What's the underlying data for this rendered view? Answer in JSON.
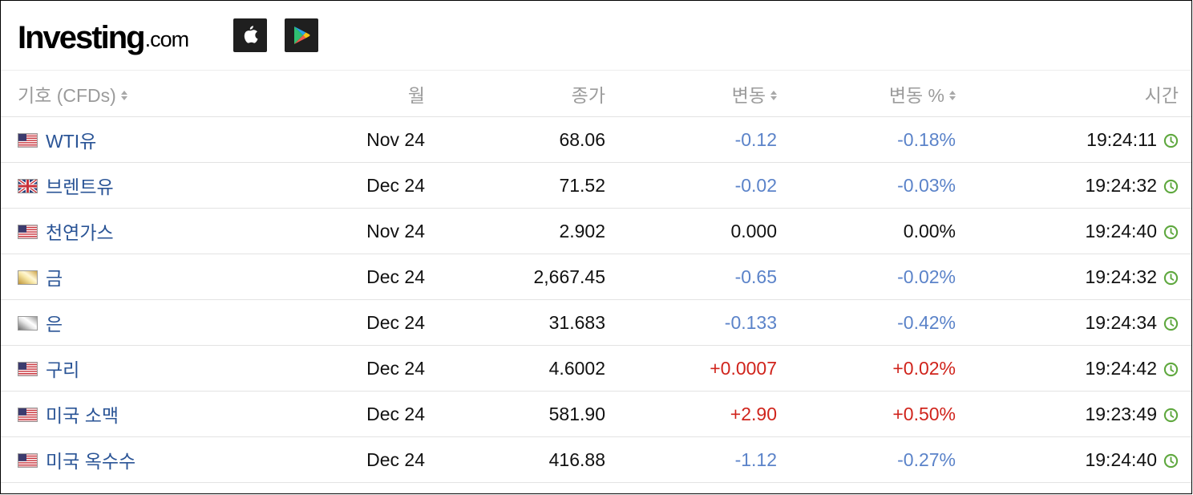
{
  "header": {
    "logo_main": "Investing",
    "logo_domain": ".com",
    "apple_icon": "apple-icon",
    "play_icon": "google-play-icon"
  },
  "columns": {
    "symbol": "기호 (CFDs)",
    "month": "월",
    "close": "종가",
    "change": "변동",
    "change_pct": "변동 %",
    "time": "시간"
  },
  "rows": [
    {
      "flag": "us",
      "symbol": "WTI유",
      "month": "Nov 24",
      "close": "68.06",
      "change": "-0.12",
      "change_pct": "-0.18%",
      "time": "19:24:11",
      "trend": "neg"
    },
    {
      "flag": "uk",
      "symbol": "브렌트유",
      "month": "Dec 24",
      "close": "71.52",
      "change": "-0.02",
      "change_pct": "-0.03%",
      "time": "19:24:32",
      "trend": "neg"
    },
    {
      "flag": "us",
      "symbol": "천연가스",
      "month": "Nov 24",
      "close": "2.902",
      "change": "0.000",
      "change_pct": "0.00%",
      "time": "19:24:40",
      "trend": "neu"
    },
    {
      "flag": "gold",
      "symbol": "금",
      "month": "Dec 24",
      "close": "2,667.45",
      "change": "-0.65",
      "change_pct": "-0.02%",
      "time": "19:24:32",
      "trend": "neg"
    },
    {
      "flag": "silver",
      "symbol": "은",
      "month": "Dec 24",
      "close": "31.683",
      "change": "-0.133",
      "change_pct": "-0.42%",
      "time": "19:24:34",
      "trend": "neg"
    },
    {
      "flag": "us",
      "symbol": "구리",
      "month": "Dec 24",
      "close": "4.6002",
      "change": "+0.0007",
      "change_pct": "+0.02%",
      "time": "19:24:42",
      "trend": "pos"
    },
    {
      "flag": "us",
      "symbol": "미국 소맥",
      "month": "Dec 24",
      "close": "581.90",
      "change": "+2.90",
      "change_pct": "+0.50%",
      "time": "19:23:49",
      "trend": "pos"
    },
    {
      "flag": "us",
      "symbol": "미국 옥수수",
      "month": "Dec 24",
      "close": "416.88",
      "change": "-1.12",
      "change_pct": "-0.27%",
      "time": "19:24:40",
      "trend": "neg"
    }
  ],
  "colors": {
    "negative": "#5b83c9",
    "positive": "#d0241c",
    "neutral": "#111111",
    "symbol_link": "#2a5496",
    "header_text": "#9b9b9b",
    "clock": "#5fa83f"
  }
}
